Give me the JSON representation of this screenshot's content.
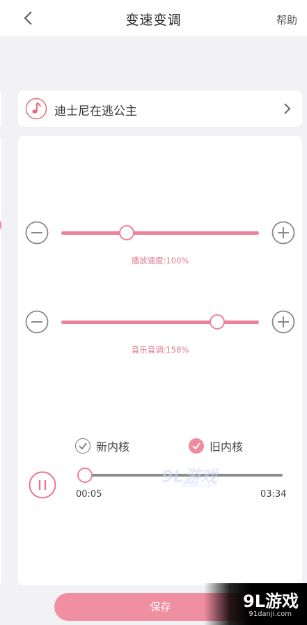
{
  "header": {
    "title": "变速变调",
    "help_label": "帮助"
  },
  "song": {
    "name": "迪士尼在逃公主",
    "icon": "music-note-icon"
  },
  "speed": {
    "caption": "播放速度:100%",
    "value_percent": 100,
    "slider_fraction": 0.33
  },
  "pitch": {
    "caption": "音乐音调:158%",
    "value_percent": 158,
    "slider_fraction": 0.79
  },
  "engines": [
    {
      "label": "新内核",
      "checked": false
    },
    {
      "label": "旧内核",
      "checked": true
    }
  ],
  "playback": {
    "current_time": "00:05",
    "total_time": "03:34",
    "progress_fraction": 0.0
  },
  "save_label": "保存",
  "watermark": {
    "mid_big": "9L游戏",
    "mid_small": "91danji.com",
    "corner_big": "9L游戏",
    "corner_small": "91danji.com"
  },
  "colors": {
    "accent": "#ed8198",
    "save_button": "#f08ea2",
    "background": "#f2f2f4"
  }
}
